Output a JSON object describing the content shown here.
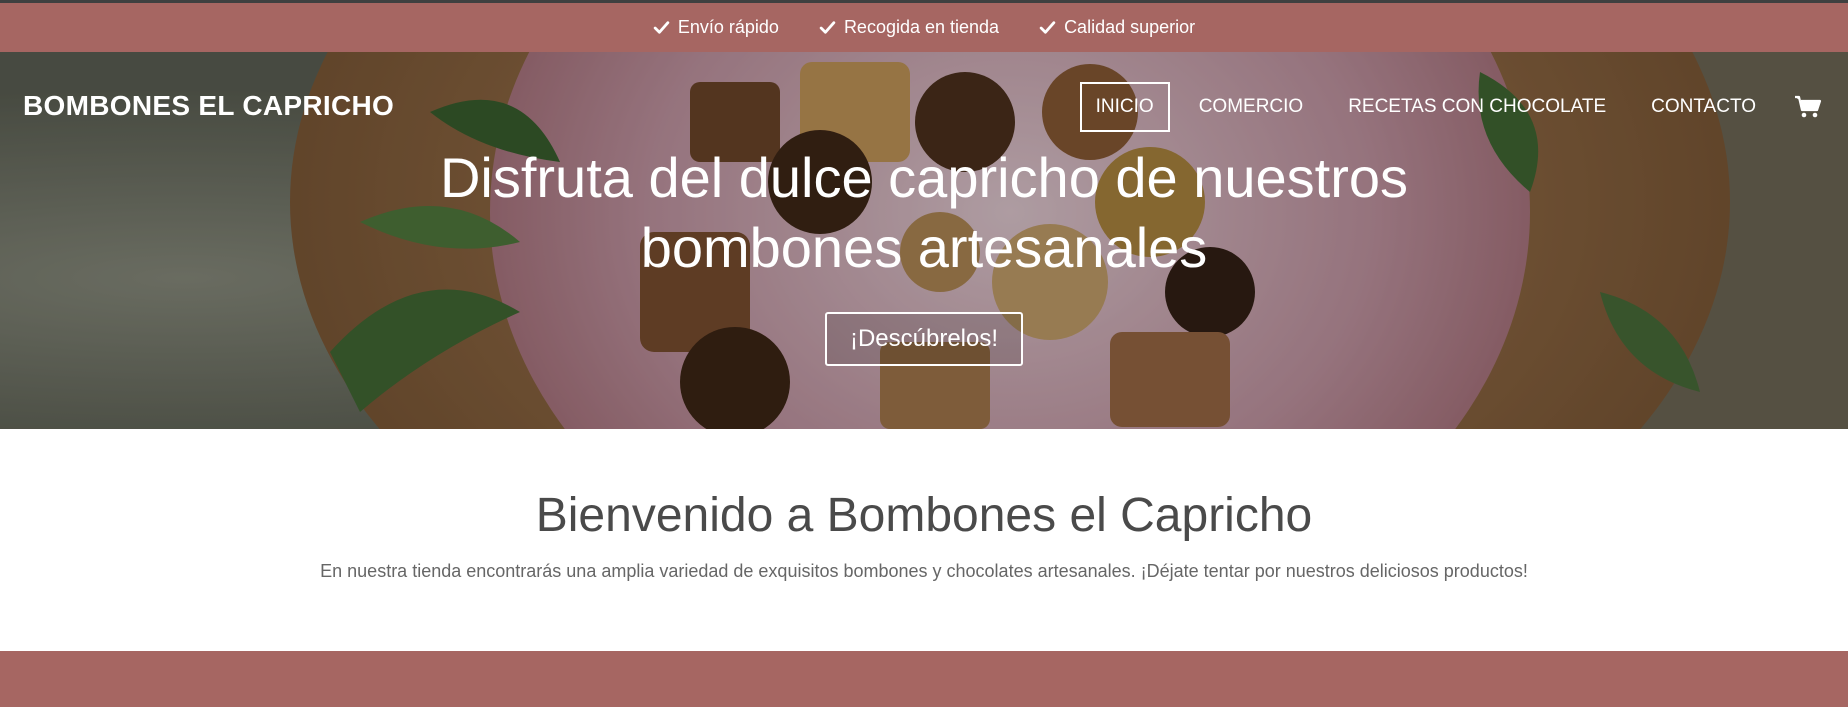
{
  "topbar": {
    "perks": [
      {
        "icon": "check-icon",
        "label": "Envío rápido"
      },
      {
        "icon": "check-icon",
        "label": "Recogida en tienda"
      },
      {
        "icon": "check-icon",
        "label": "Calidad superior"
      }
    ]
  },
  "header": {
    "brand": "BOMBONES EL CAPRICHO",
    "nav": [
      {
        "label": "INICIO",
        "active": true
      },
      {
        "label": "COMERCIO",
        "active": false
      },
      {
        "label": "RECETAS CON CHOCOLATE",
        "active": false
      },
      {
        "label": "CONTACTO",
        "active": false
      }
    ],
    "cart_icon": "shopping-cart-icon"
  },
  "hero": {
    "title_line1": "Disfruta del dulce capricho de nuestros",
    "title_line2": "bombones artesanales",
    "button_label": "¡Descúbrelos!"
  },
  "welcome": {
    "heading": "Bienvenido a Bombones el Capricho",
    "text": "En nuestra tienda encontrarás una amplia variedad de exquisitos bombones y chocolates artesanales. ¡Déjate tentar por nuestros deliciosos productos!"
  },
  "colors": {
    "accent": "#a66662",
    "dark_border": "#3f4040",
    "heading_text": "#4a4a4a"
  }
}
